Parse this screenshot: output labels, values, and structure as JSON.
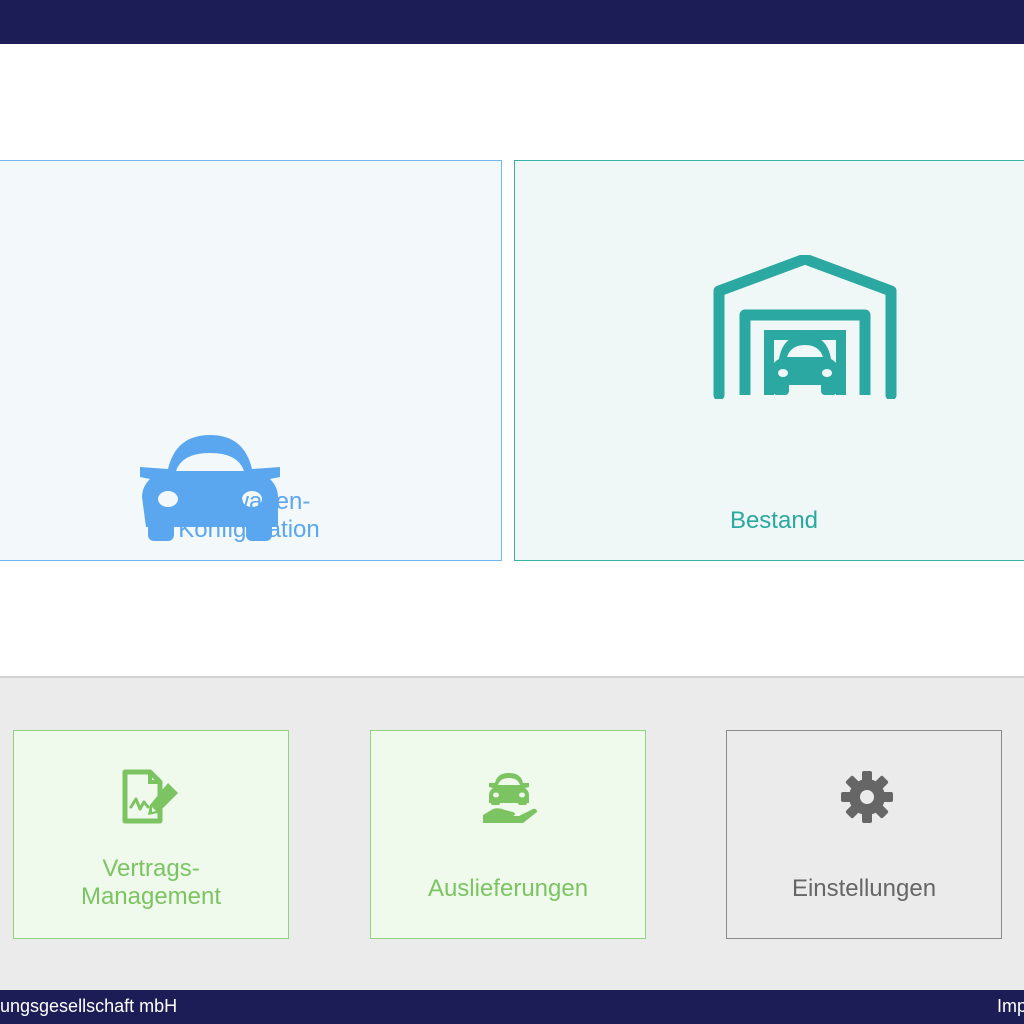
{
  "tiles": {
    "new_car": {
      "label": "Neuwagen-\nKonfiguration",
      "icon": "car-front-icon",
      "color": "#5aa7f0"
    },
    "stock": {
      "label": "Bestand",
      "icon": "garage-car-icon",
      "color": "#2aa8a1"
    }
  },
  "modules": {
    "contract": {
      "label": "Vertrags-\nManagement",
      "icon": "contract-signature-icon",
      "color": "#7cc462"
    },
    "deliveries": {
      "label": "Auslieferungen",
      "icon": "car-delivery-hand-icon",
      "color": "#7cc462"
    },
    "settings": {
      "label": "Einstellungen",
      "icon": "gear-icon",
      "color": "#666666"
    }
  },
  "footer": {
    "left_text": "ungsgesellschaft mbH",
    "right_text": "Imp"
  },
  "colors": {
    "header_bg": "#1c1c57",
    "lower_bg": "#ebebeb"
  }
}
